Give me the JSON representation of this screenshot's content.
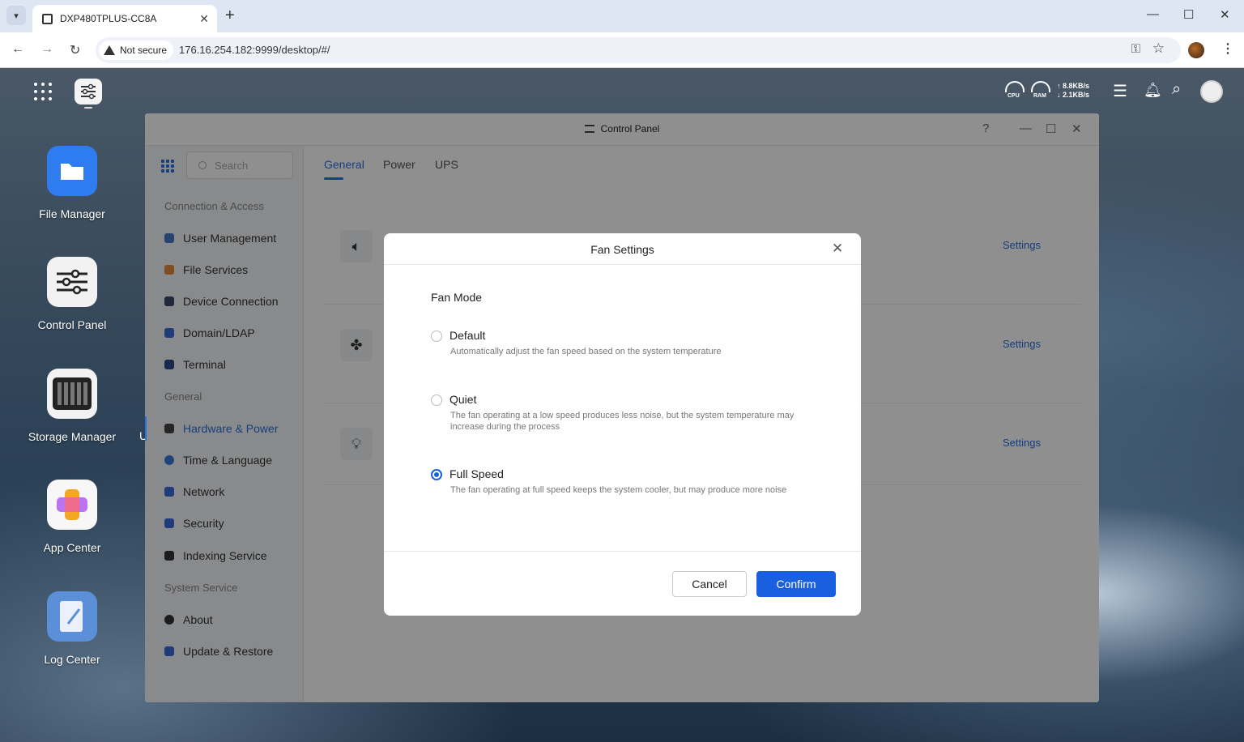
{
  "browser": {
    "tab_title": "DXP480TPLUS-CC8A",
    "security_label": "Not secure",
    "url": "176.16.254.182:9999/desktop/#/"
  },
  "topbar": {
    "cpu_label": "CPU",
    "ram_label": "RAM",
    "upload_speed": "↑ 8.8KB/s",
    "download_speed": "↓ 2.1KB/s"
  },
  "desktop": {
    "icons": [
      {
        "label": "File Manager",
        "color": "#2f7cf0"
      },
      {
        "label": "Control Panel",
        "color": "#f2f2f2"
      },
      {
        "label": "Storage Manager",
        "color": "#f2f2f2"
      },
      {
        "label": "App Center",
        "color": "#f7f7f7"
      },
      {
        "label": "Log Center",
        "color": "#5b8fd8"
      }
    ],
    "partial_label": "U"
  },
  "control_panel": {
    "title": "Control Panel",
    "help": "?",
    "search_placeholder": "Search",
    "sidebar": {
      "groups": [
        "Connection & Access",
        "General",
        "System Service"
      ],
      "items": [
        {
          "label": "User Management",
          "color": "#4a78c8"
        },
        {
          "label": "File Services",
          "color": "#e08a3c"
        },
        {
          "label": "Device Connection",
          "color": "#3a4a6a"
        },
        {
          "label": "Domain/LDAP",
          "color": "#3a6ad8"
        },
        {
          "label": "Terminal",
          "color": "#2a4a8a"
        },
        {
          "label": "Hardware & Power",
          "color": "#444444"
        },
        {
          "label": "Time & Language",
          "color": "#3a7ad8"
        },
        {
          "label": "Network",
          "color": "#3a6ad8"
        },
        {
          "label": "Security",
          "color": "#3a6ad8"
        },
        {
          "label": "Indexing Service",
          "color": "#333333"
        },
        {
          "label": "About",
          "color": "#333333"
        },
        {
          "label": "Update & Restore",
          "color": "#3a6ad8"
        }
      ]
    },
    "tabs": [
      "General",
      "Power",
      "UPS"
    ],
    "settings_link": "Settings"
  },
  "dialog": {
    "title": "Fan Settings",
    "section_label": "Fan Mode",
    "options": [
      {
        "label": "Default",
        "description": "Automatically adjust the fan speed based on the system temperature"
      },
      {
        "label": "Quiet",
        "description": "The fan operating at a low speed produces less noise, but the system temperature may increase during the process"
      },
      {
        "label": "Full Speed",
        "description": "The fan operating at full speed keeps the system cooler, but may produce more noise"
      }
    ],
    "selected": "Full Speed",
    "cancel_label": "Cancel",
    "confirm_label": "Confirm"
  },
  "colors": {
    "accent": "#1a5fe0",
    "link": "#2a6fe0"
  }
}
